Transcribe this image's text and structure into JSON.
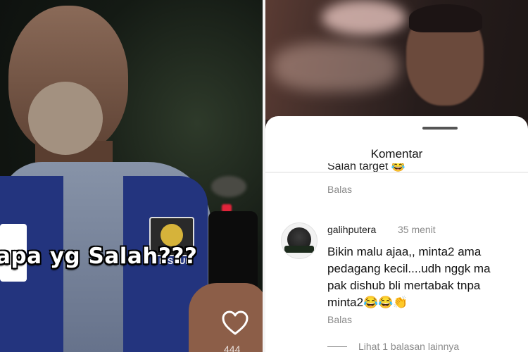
{
  "left_video": {
    "caption": "apa yg Salah???",
    "badge_text": "DISHUB",
    "like_icon": "heart-outline-icon",
    "like_count": "444"
  },
  "right_video": {
    "comments_sheet": {
      "title": "Komentar",
      "previous_comment_partial": "Salah target 😂",
      "previous_reply_label": "Balas",
      "comment": {
        "avatar_icon": "avatar-icon",
        "username": "galihputera",
        "time": "35 menit",
        "lines": [
          "Bikin malu ajaa,, minta2 ama",
          "pedagang kecil....udh nggk ma",
          "pak dishub bli mertabak tnpa",
          "minta2😂😂👏"
        ],
        "reply_label": "Balas",
        "view_more_replies": "Lihat 1 balasan lainnya"
      }
    }
  },
  "colors": {
    "sheet_bg": "#ffffff",
    "muted_text": "#8a8a8a",
    "divider": "#f4f4f4"
  }
}
